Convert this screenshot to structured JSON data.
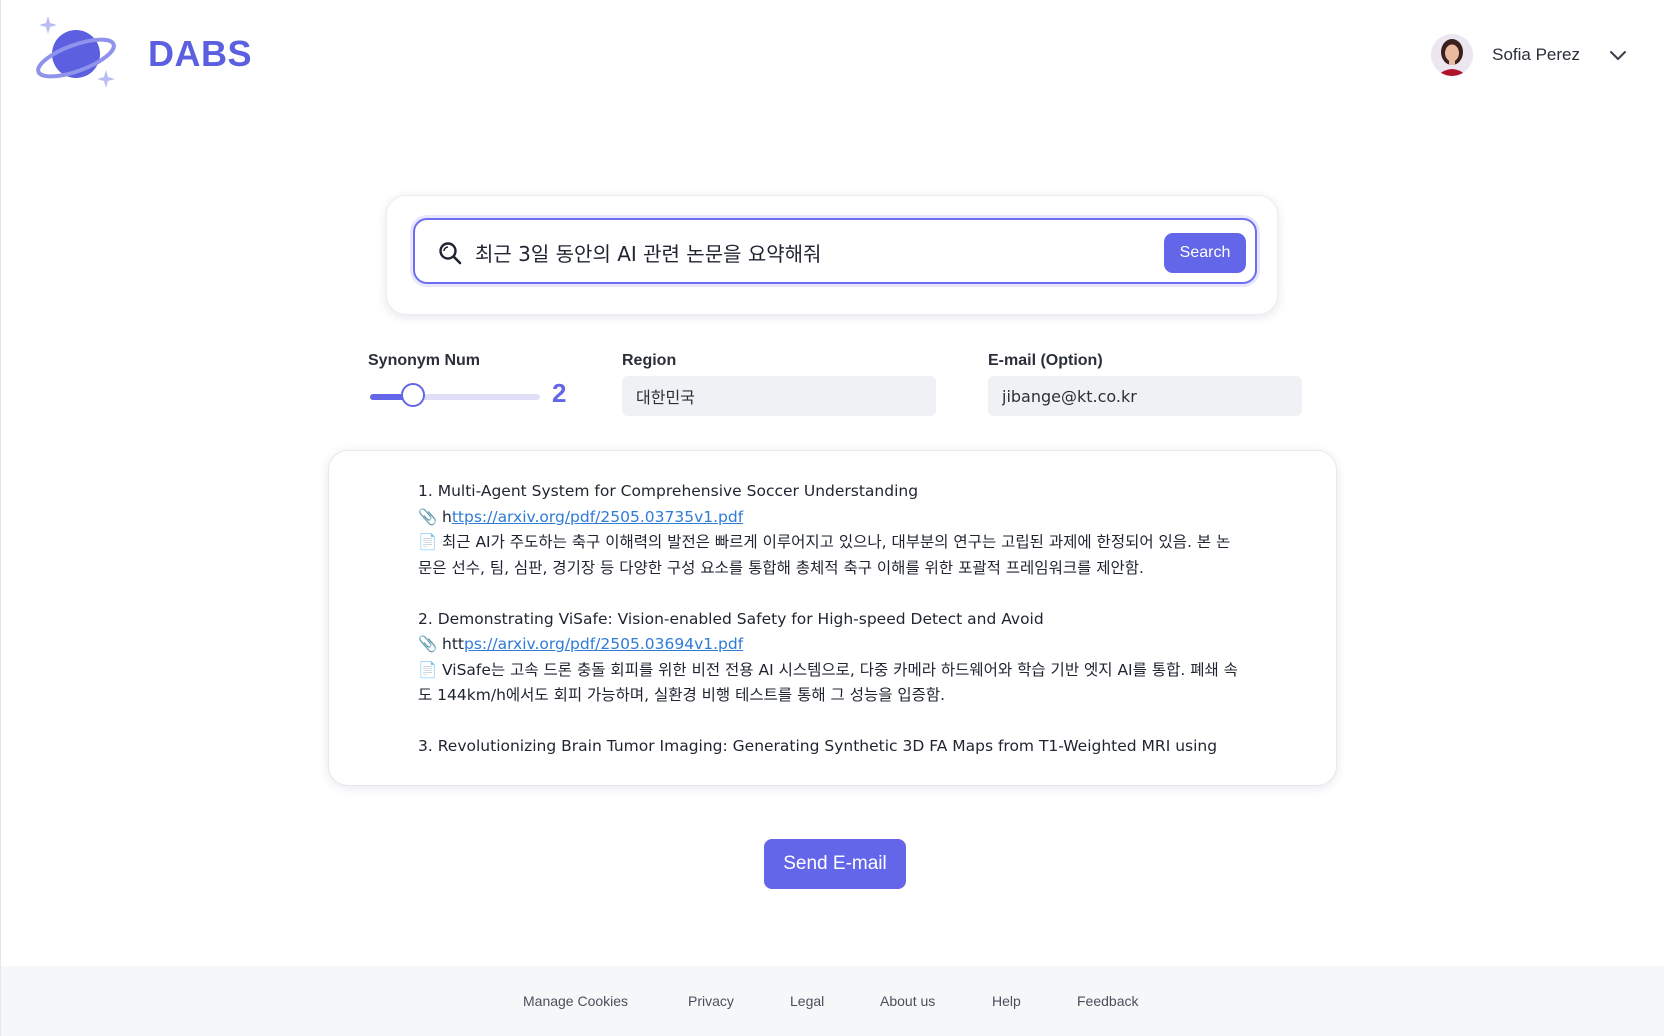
{
  "brand": {
    "name": "DABS",
    "accent": "#6366e8"
  },
  "user": {
    "name": "Sofia Perez",
    "avatar_icon": "user-avatar",
    "menu_icon": "chevron-down-icon"
  },
  "search": {
    "query": "최근 3일 동안의 AI 관련 논문을 요약해줘",
    "button_label": "Search",
    "icon": "search-icon"
  },
  "controls": {
    "synonym": {
      "label": "Synonym Num",
      "value": "2",
      "fraction": 0.25
    },
    "region": {
      "label": "Region",
      "value": "대한민국"
    },
    "email": {
      "label": "E-mail (Option)",
      "value": "jibange@kt.co.kr"
    }
  },
  "results": [
    {
      "title": "1. Multi-Agent System for Comprehensive Soccer Understanding",
      "link_prefix": "h",
      "link_text": "ttps://arxiv.org/pdf/2505.03735v1.pdf",
      "summary": "최근 AI가 주도하는 축구 이해력의 발전은 빠르게 이루어지고 있으나, 대부분의 연구는 고립된 과제에 한정되어 있음. 본 논문은 선수, 팀, 심판, 경기장 등 다양한 구성 요소를 통합해 총체적 축구 이해를 위한 포괄적 프레임워크를 제안함."
    },
    {
      "title": "2. Demonstrating ViSafe: Vision-enabled Safety for High-speed Detect and Avoid",
      "link_prefix": "htt",
      "link_text": "ps://arxiv.org/pdf/2505.03694v1.pdf",
      "summary": "ViSafe는 고속 드론 충돌 회피를 위한 비전 전용 AI 시스템으로, 다중 카메라 하드웨어와 학습 기반 엣지 AI를 통합. 폐쇄 속도 144km/h에서도 회피 가능하며, 실환경 비행 테스트를 통해 그 성능을 입증함."
    },
    {
      "title": "3. Revolutionizing Brain Tumor Imaging: Generating Synthetic 3D FA Maps from T1-Weighted MRI using"
    }
  ],
  "icons": {
    "link": "paperclip-icon",
    "summary": "document-icon"
  },
  "send_button": "Send E-mail",
  "footer": {
    "links": [
      "Manage Cookies",
      "Privacy",
      "Legal",
      "About us",
      "Help",
      "Feedback"
    ]
  }
}
